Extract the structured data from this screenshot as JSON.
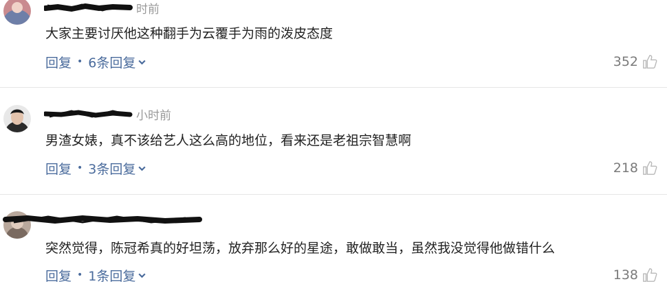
{
  "comments": [
    {
      "time": "时前",
      "text": "大家主要讨厌他这种翻手为云覆手为雨的泼皮态度",
      "reply_label": "回复",
      "sub_replies": "6条回复",
      "likes": "352",
      "avatar_icon": "user-avatar-icon"
    },
    {
      "time": "小时前",
      "text": "男渣女婊，真不该给艺人这么高的地位，看来还是老祖宗智慧啊",
      "reply_label": "回复",
      "sub_replies": "3条回复",
      "likes": "218",
      "avatar_icon": "user-avatar-icon"
    },
    {
      "time": "",
      "text": "突然觉得，陈冠希真的好坦荡，放弃那么好的星途，敢做敢当，虽然我没觉得他做错什么",
      "reply_label": "回复",
      "sub_replies": "1条回复",
      "likes": "138",
      "avatar_icon": "user-avatar-icon"
    }
  ],
  "colors": {
    "link": "#4a6b9c",
    "text": "#222222",
    "meta": "#999999",
    "divider": "#e6e6e6"
  }
}
